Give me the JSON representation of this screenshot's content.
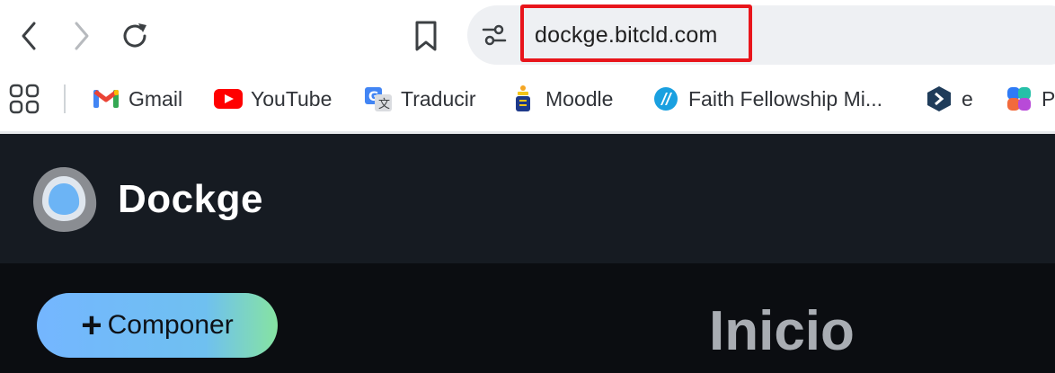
{
  "browser": {
    "url": "dockge.bitcld.com",
    "bookmarks": [
      {
        "label": "Gmail",
        "icon": "gmail-icon"
      },
      {
        "label": "YouTube",
        "icon": "youtube-icon"
      },
      {
        "label": "Traducir",
        "icon": "translate-icon"
      },
      {
        "label": "Moodle",
        "icon": "moodle-icon"
      },
      {
        "label": "Faith Fellowship Mi...",
        "icon": "faith-fellowship-icon"
      },
      {
        "label": "e",
        "icon": "e-site-icon"
      },
      {
        "label": "P",
        "icon": "copilot-icon"
      }
    ]
  },
  "app": {
    "name": "Dockge",
    "compose_label": "Componer",
    "compose_symbol": "+",
    "page_title": "Inicio"
  },
  "colors": {
    "highlight": "#e8151b",
    "header_bg": "#161b22",
    "main_bg": "#0b0d11",
    "compose_gradient": [
      "#74b6ff",
      "#86e3a2"
    ],
    "title": "#a9adb3"
  }
}
